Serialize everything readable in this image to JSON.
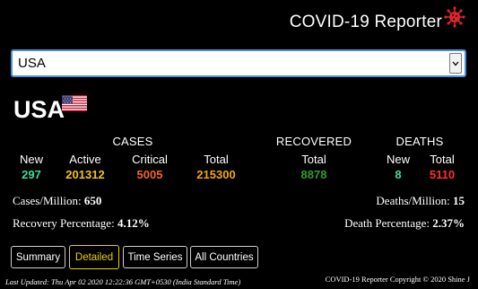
{
  "header": {
    "title": "COVID-19 Reporter",
    "icon": "virus-icon",
    "icon_color": "#e0242a"
  },
  "country_select": {
    "value": "USA",
    "arrow_icon": "chevron-down-icon"
  },
  "country": {
    "name": "USA",
    "flag_icon": "us-flag-icon"
  },
  "cases": {
    "title": "CASES",
    "new_label": "New",
    "new_value": "297",
    "active_label": "Active",
    "active_value": "201312",
    "critical_label": "Critical",
    "critical_value": "5005",
    "total_label": "Total",
    "total_value": "215300"
  },
  "recovered": {
    "title": "RECOVERED",
    "total_label": "Total",
    "total_value": "8878"
  },
  "deaths": {
    "title": "DEATHS",
    "new_label": "New",
    "new_value": "8",
    "total_label": "Total",
    "total_value": "5110"
  },
  "colors": {
    "new": "#3ddc97",
    "active": "#f2c21b",
    "critical": "#f26522",
    "total_cases": "#f2a900",
    "recovered": "#2e9e2e",
    "deaths_total": "#ff3030",
    "active_tab": "#f0d000"
  },
  "summary": {
    "cases_per_million_label": "Cases/Million:",
    "cases_per_million_value": "650",
    "deaths_per_million_label": "Deaths/Million:",
    "deaths_per_million_value": "15",
    "recovery_pct_label": "Recovery Percentage:",
    "recovery_pct_value": "4.12%",
    "death_pct_label": "Death Percentage:",
    "death_pct_value": "2.37%"
  },
  "tabs": [
    {
      "label": "Summary",
      "active": false
    },
    {
      "label": "Detailed",
      "active": true
    },
    {
      "label": "Time Series",
      "active": false
    },
    {
      "label": "All Countries",
      "active": false
    }
  ],
  "footer": {
    "last_updated": "Last Updated: Thu Apr 02 2020 12:22:36 GMT+0530 (India Standard Time)",
    "copyright": "COVID-19 Reporter Copyright © 2020 Shine J"
  }
}
